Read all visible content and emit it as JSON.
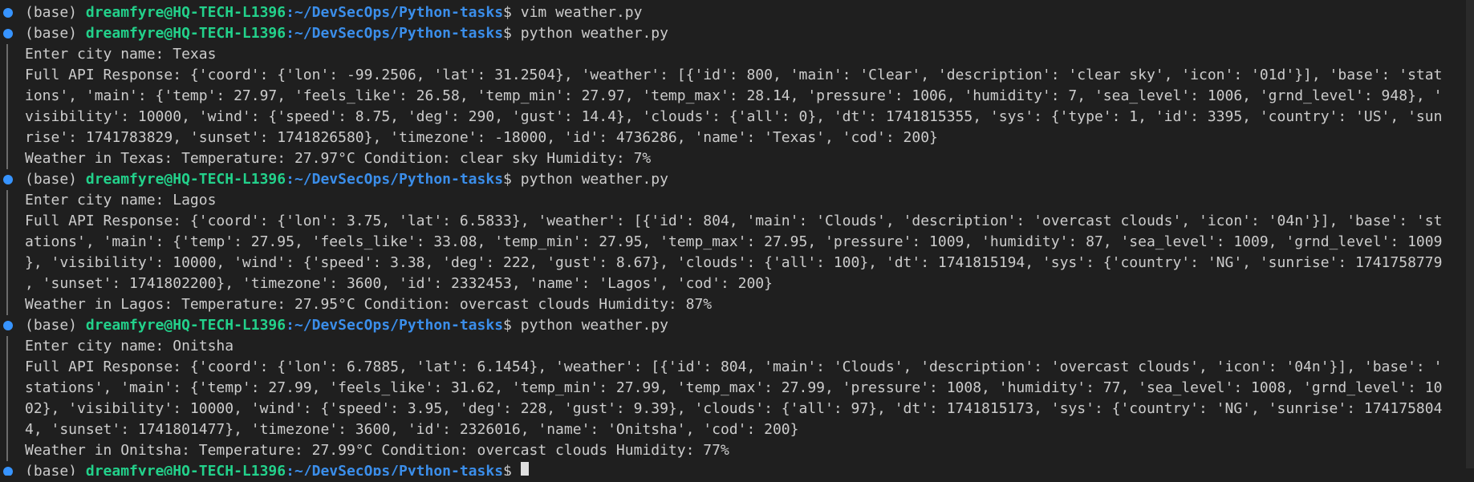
{
  "prompt": {
    "env": "(base) ",
    "user_host": "dreamfyre@HQ-TECH-L1396",
    "path": ":~/DevSecOps/Python-tasks",
    "symbol": "$ "
  },
  "lines": [
    {
      "kind": "prompt",
      "cmd": "vim weather.py"
    },
    {
      "kind": "prompt",
      "cmd": "python weather.py"
    },
    {
      "kind": "out",
      "text": "Enter city name: Texas"
    },
    {
      "kind": "out",
      "text": "Full API Response: {'coord': {'lon': -99.2506, 'lat': 31.2504}, 'weather': [{'id': 800, 'main': 'Clear', 'description': 'clear sky', 'icon': '01d'}], 'base': 'stat"
    },
    {
      "kind": "out",
      "text": "ions', 'main': {'temp': 27.97, 'feels_like': 26.58, 'temp_min': 27.97, 'temp_max': 28.14, 'pressure': 1006, 'humidity': 7, 'sea_level': 1006, 'grnd_level': 948}, '"
    },
    {
      "kind": "out",
      "text": "visibility': 10000, 'wind': {'speed': 8.75, 'deg': 290, 'gust': 14.4}, 'clouds': {'all': 0}, 'dt': 1741815355, 'sys': {'type': 1, 'id': 3395, 'country': 'US', 'sun"
    },
    {
      "kind": "out",
      "text": "rise': 1741783829, 'sunset': 1741826580}, 'timezone': -18000, 'id': 4736286, 'name': 'Texas', 'cod': 200}"
    },
    {
      "kind": "out",
      "text": "Weather in Texas: Temperature: 27.97°C Condition: clear sky Humidity: 7%"
    },
    {
      "kind": "prompt",
      "cmd": "python weather.py"
    },
    {
      "kind": "out",
      "text": "Enter city name: Lagos"
    },
    {
      "kind": "out",
      "text": "Full API Response: {'coord': {'lon': 3.75, 'lat': 6.5833}, 'weather': [{'id': 804, 'main': 'Clouds', 'description': 'overcast clouds', 'icon': '04n'}], 'base': 'st"
    },
    {
      "kind": "out",
      "text": "ations', 'main': {'temp': 27.95, 'feels_like': 33.08, 'temp_min': 27.95, 'temp_max': 27.95, 'pressure': 1009, 'humidity': 87, 'sea_level': 1009, 'grnd_level': 1009"
    },
    {
      "kind": "out",
      "text": "}, 'visibility': 10000, 'wind': {'speed': 3.38, 'deg': 222, 'gust': 8.67}, 'clouds': {'all': 100}, 'dt': 1741815194, 'sys': {'country': 'NG', 'sunrise': 1741758779"
    },
    {
      "kind": "out",
      "text": ", 'sunset': 1741802200}, 'timezone': 3600, 'id': 2332453, 'name': 'Lagos', 'cod': 200}"
    },
    {
      "kind": "out",
      "text": "Weather in Lagos: Temperature: 27.95°C Condition: overcast clouds Humidity: 87%"
    },
    {
      "kind": "prompt",
      "cmd": "python weather.py"
    },
    {
      "kind": "out",
      "text": "Enter city name: Onitsha"
    },
    {
      "kind": "out",
      "text": "Full API Response: {'coord': {'lon': 6.7885, 'lat': 6.1454}, 'weather': [{'id': 804, 'main': 'Clouds', 'description': 'overcast clouds', 'icon': '04n'}], 'base': '"
    },
    {
      "kind": "out",
      "text": "stations', 'main': {'temp': 27.99, 'feels_like': 31.62, 'temp_min': 27.99, 'temp_max': 27.99, 'pressure': 1008, 'humidity': 77, 'sea_level': 1008, 'grnd_level': 10"
    },
    {
      "kind": "out",
      "text": "02}, 'visibility': 10000, 'wind': {'speed': 3.95, 'deg': 228, 'gust': 9.39}, 'clouds': {'all': 97}, 'dt': 1741815173, 'sys': {'country': 'NG', 'sunrise': 174175804"
    },
    {
      "kind": "out",
      "text": "4, 'sunset': 1741801477}, 'timezone': 3600, 'id': 2326016, 'name': 'Onitsha', 'cod': 200}"
    },
    {
      "kind": "out",
      "text": "Weather in Onitsha: Temperature: 27.99°C Condition: overcast clouds Humidity: 77%"
    },
    {
      "kind": "prompt",
      "cmd": "",
      "cursor": true
    }
  ],
  "colors": {
    "background": "#1f1f1f",
    "text": "#cccccc",
    "user_host": "#23d18b",
    "path": "#3b8eea",
    "decoration_dot": "#3794ff"
  }
}
